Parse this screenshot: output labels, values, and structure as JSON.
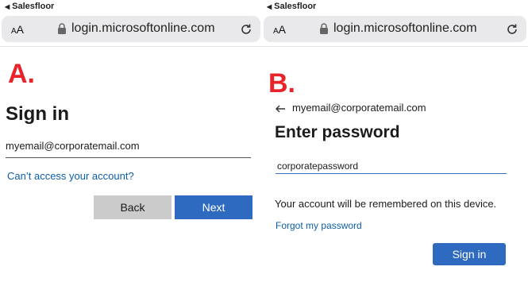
{
  "panel_a": {
    "status_text": "Salesfloor",
    "aa_label": "AA",
    "url": "login.microsoftonline.com",
    "marker": "A.",
    "title": "Sign in",
    "email_value": "myemail@corporatemail.com",
    "cant_access_link": "Can’t access your account?",
    "back_label": "Back",
    "next_label": "Next"
  },
  "panel_b": {
    "status_text": "Salesfloor",
    "aa_label": "AA",
    "url": "login.microsoftonline.com",
    "marker": "B.",
    "email": "myemail@corporatemail.com",
    "title": "Enter password",
    "password_value": "corporatepassword",
    "remember_text": "Your account will be remembered on this device.",
    "forgot_link": "Forgot my password",
    "signin_label": "Sign in"
  },
  "colors": {
    "marker_red": "#e8232a",
    "primary_blue": "#2e6bc0",
    "link_blue": "#0c5ea8",
    "back_gray": "#cbcbcb"
  },
  "icons": [
    "lock-icon",
    "reload-icon",
    "back-arrow-icon"
  ]
}
